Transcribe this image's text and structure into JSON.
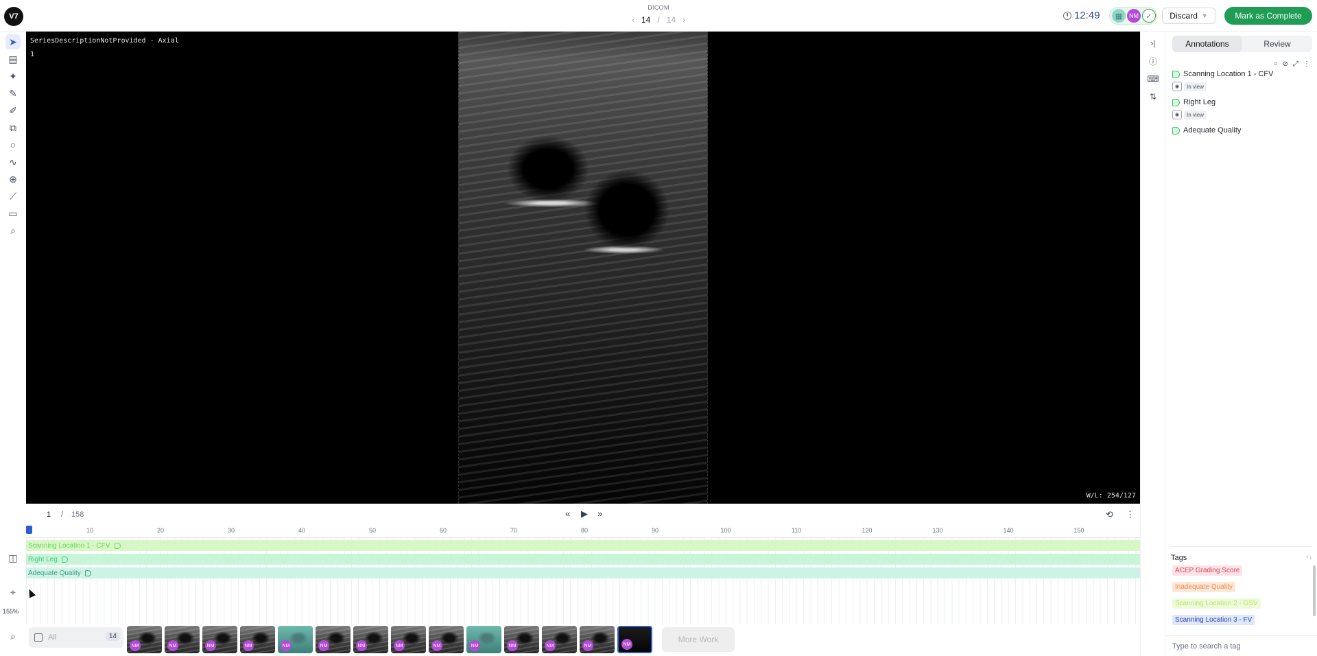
{
  "header": {
    "logo": "V7",
    "file_type": "DICOM",
    "current_item": "14",
    "separator": "/",
    "total_items": "14",
    "timer": "12:49",
    "user_initials": "NM",
    "discard_label": "Discard",
    "complete_label": "Mark as Complete",
    "accent_color": "#1f9d55"
  },
  "viewer": {
    "series_description": "SeriesDescriptionNotProvided - Axial",
    "slice_index": "1",
    "window_level": "W/L: 254/127",
    "zoom": "155%"
  },
  "timeline": {
    "current_frame": "1",
    "separator": "/",
    "total_frames": "158",
    "ticks": [
      "10",
      "20",
      "30",
      "40",
      "50",
      "60",
      "70",
      "80",
      "90",
      "100",
      "110",
      "120",
      "130",
      "140",
      "150"
    ],
    "tracks": [
      "Scanning Location 1 - CFV",
      "Right Leg",
      "Adequate Quality"
    ]
  },
  "filmstrip": {
    "filter_label": "All",
    "count": "14",
    "more_work_label": "More Work",
    "thumbnail_badge": "NM"
  },
  "panel": {
    "tabs": [
      "Annotations",
      "Review"
    ],
    "annotations": [
      {
        "label": "Scanning Location 1 - CFV",
        "status": "In view"
      },
      {
        "label": "Right Leg",
        "status": "In view"
      },
      {
        "label": "Adequate Quality",
        "status": ""
      }
    ],
    "tags_title": "Tags",
    "tags": [
      "ACEP Grading Score",
      "Inadequate Quality",
      "Scanning Location 2 - GSV",
      "Scanning Location 3 - FV"
    ],
    "tag_placeholder": "Type to search a tag"
  }
}
